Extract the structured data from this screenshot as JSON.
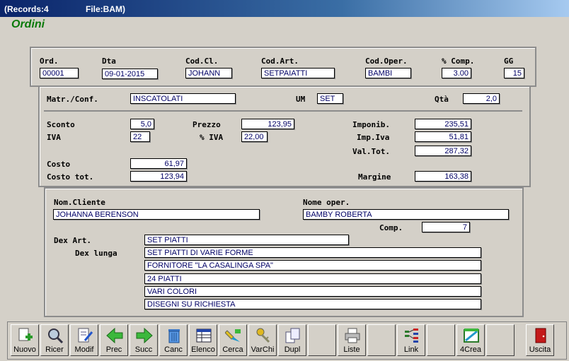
{
  "titlebar": {
    "records": "(Records:4",
    "file": "File:BAM)"
  },
  "form_title": "Ordini",
  "header": {
    "ord_label": "Ord.",
    "ord_value": "00001",
    "dta_label": "Dta",
    "dta_value": "09-01-2015",
    "codcl_label": "Cod.Cl.",
    "codcl_value": "JOHANN",
    "codart_label": "Cod.Art.",
    "codart_value": "SETPAIATTI",
    "codoper_label": "Cod.Oper.",
    "codoper_value": "BAMBI",
    "comp_label": "% Comp.",
    "comp_value": "3.00",
    "gg_label": "GG",
    "gg_value": "15"
  },
  "detail": {
    "matr_label": "Matr./Conf.",
    "matr_value": "INSCATOLATI",
    "um_label": "UM",
    "um_value": "SET",
    "qta_label": "Qtà",
    "qta_value": "2,0",
    "sconto_label": "Sconto",
    "sconto_value": "5,0",
    "prezzo_label": "Prezzo",
    "prezzo_value": "123,95",
    "imponib_label": "Imponib.",
    "imponib_value": "235,51",
    "iva_label": "IVA",
    "iva_value": "22",
    "piva_label": "% IVA",
    "piva_value": "22,00",
    "impiva_label": "Imp.Iva",
    "impiva_value": "51,81",
    "valtot_label": "Val.Tot.",
    "valtot_value": "287,32",
    "costo_label": "Costo",
    "costo_value": "61,97",
    "costotot_label": "Costo tot.",
    "costotot_value": "123,94",
    "margine_label": "Margine",
    "margine_value": "163,38"
  },
  "client": {
    "nomcliente_label": "Nom.Cliente",
    "nomcliente_value": "JOHANNA BERENSON",
    "nomeoper_label": "Nome oper.",
    "nomeoper_value": "BAMBY ROBERTA",
    "comp_label": "Comp.",
    "comp_value": "7",
    "dexart_label": "Dex Art.",
    "dexart_value": "SET PIATTI",
    "dexlunga_label": "Dex lunga",
    "dexlunga_lines": [
      "SET PIATTI DI VARIE FORME",
      "FORNITORE \"LA CASALINGA SPA\"",
      "24 PIATTI",
      "VARI COLORI",
      "DISEGNI SU RICHIESTA"
    ]
  },
  "toolbar": {
    "buttons": [
      {
        "label": "Nuovo",
        "icon": "new-document-icon"
      },
      {
        "label": "Ricer",
        "icon": "magnifier-icon"
      },
      {
        "label": "Modif",
        "icon": "edit-document-icon"
      },
      {
        "label": "Prec",
        "icon": "arrow-left-icon"
      },
      {
        "label": "Succ",
        "icon": "arrow-right-icon"
      },
      {
        "label": "Canc",
        "icon": "trash-icon"
      },
      {
        "label": "Elenco",
        "icon": "table-icon"
      },
      {
        "label": "Cerca",
        "icon": "highlighter-icon"
      },
      {
        "label": "VarChi",
        "icon": "keys-icon"
      },
      {
        "label": "Dupl",
        "icon": "duplicate-icon"
      },
      {
        "label": "",
        "icon": ""
      },
      {
        "label": "Liste",
        "icon": "printer-icon"
      },
      {
        "label": "",
        "icon": ""
      },
      {
        "label": "Link",
        "icon": "link-icon"
      },
      {
        "label": "",
        "icon": ""
      },
      {
        "label": "4Crea",
        "icon": "create-icon"
      },
      {
        "label": "",
        "icon": ""
      },
      {
        "label": "Uscita",
        "icon": "exit-door-icon"
      }
    ]
  },
  "colors": {
    "title_green": "#0a7a0a",
    "field_text": "#000066",
    "window_bg": "#d4d0c8"
  }
}
